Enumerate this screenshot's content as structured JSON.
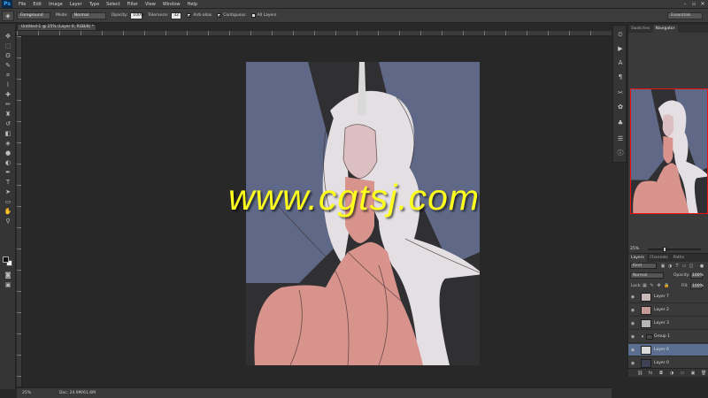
{
  "app": {
    "logo": "Ps"
  },
  "menu": [
    "File",
    "Edit",
    "Image",
    "Layer",
    "Type",
    "Select",
    "Filter",
    "View",
    "Window",
    "Help"
  ],
  "window_controls": [
    "–",
    "▫",
    "✕"
  ],
  "options": {
    "tool_preset": "Foreground",
    "mode_label": "Mode:",
    "mode_value": "Normal",
    "opacity_label": "Opacity:",
    "opacity_value": "100%",
    "tolerance_label": "Tolerance:",
    "tolerance_value": "32",
    "anti_alias_label": "Anti-alias",
    "contiguous_label": "Contiguous",
    "all_layers_label": "All Layers",
    "anti_alias_checked": true,
    "contiguous_checked": true,
    "all_layers_checked": false,
    "workspace": "Essentials"
  },
  "document": {
    "tab_title": "Untitled-1 @ 25% (Layer 6, RGB/8) *",
    "zoom": "25%",
    "doc_size": "Doc: 24.9M/61.6M"
  },
  "navigator": {
    "tabs": [
      "Swatches",
      "Navigator"
    ],
    "active_tab": "Navigator",
    "zoom": "25%",
    "zoom_level": 0.3
  },
  "layers_panel": {
    "tabs": [
      "Layers",
      "Channels",
      "Paths"
    ],
    "active_tab": "Layers",
    "kind_label": "Kind",
    "blend_mode": "Normal",
    "opacity_label": "Opacity:",
    "opacity_value": "100%",
    "lock_label": "Lock:",
    "fill_label": "Fill:",
    "fill_value": "100%",
    "layers": [
      {
        "name": "Layer 7",
        "thumb": "#c8b8b8",
        "selected": false,
        "group": false
      },
      {
        "name": "Layer 2",
        "thumb": "#c39a95",
        "selected": false,
        "group": false
      },
      {
        "name": "Layer 3",
        "thumb": "#b5b5b5",
        "selected": false,
        "group": false
      },
      {
        "name": "Group 1",
        "thumb": "#4a4a4a",
        "selected": false,
        "group": true
      },
      {
        "name": "Layer 6",
        "thumb": "#d9d9d9",
        "selected": true,
        "group": false
      },
      {
        "name": "Layer 0",
        "thumb": "#3f4257",
        "selected": false,
        "group": false
      }
    ]
  },
  "colors": {
    "skin": "#d8938c",
    "hair": "#e4dfe2",
    "wing": "#5f6987",
    "dark_bg": "#303033",
    "selection": "#5a6f8f"
  },
  "watermark": "www.cgtsj.com"
}
